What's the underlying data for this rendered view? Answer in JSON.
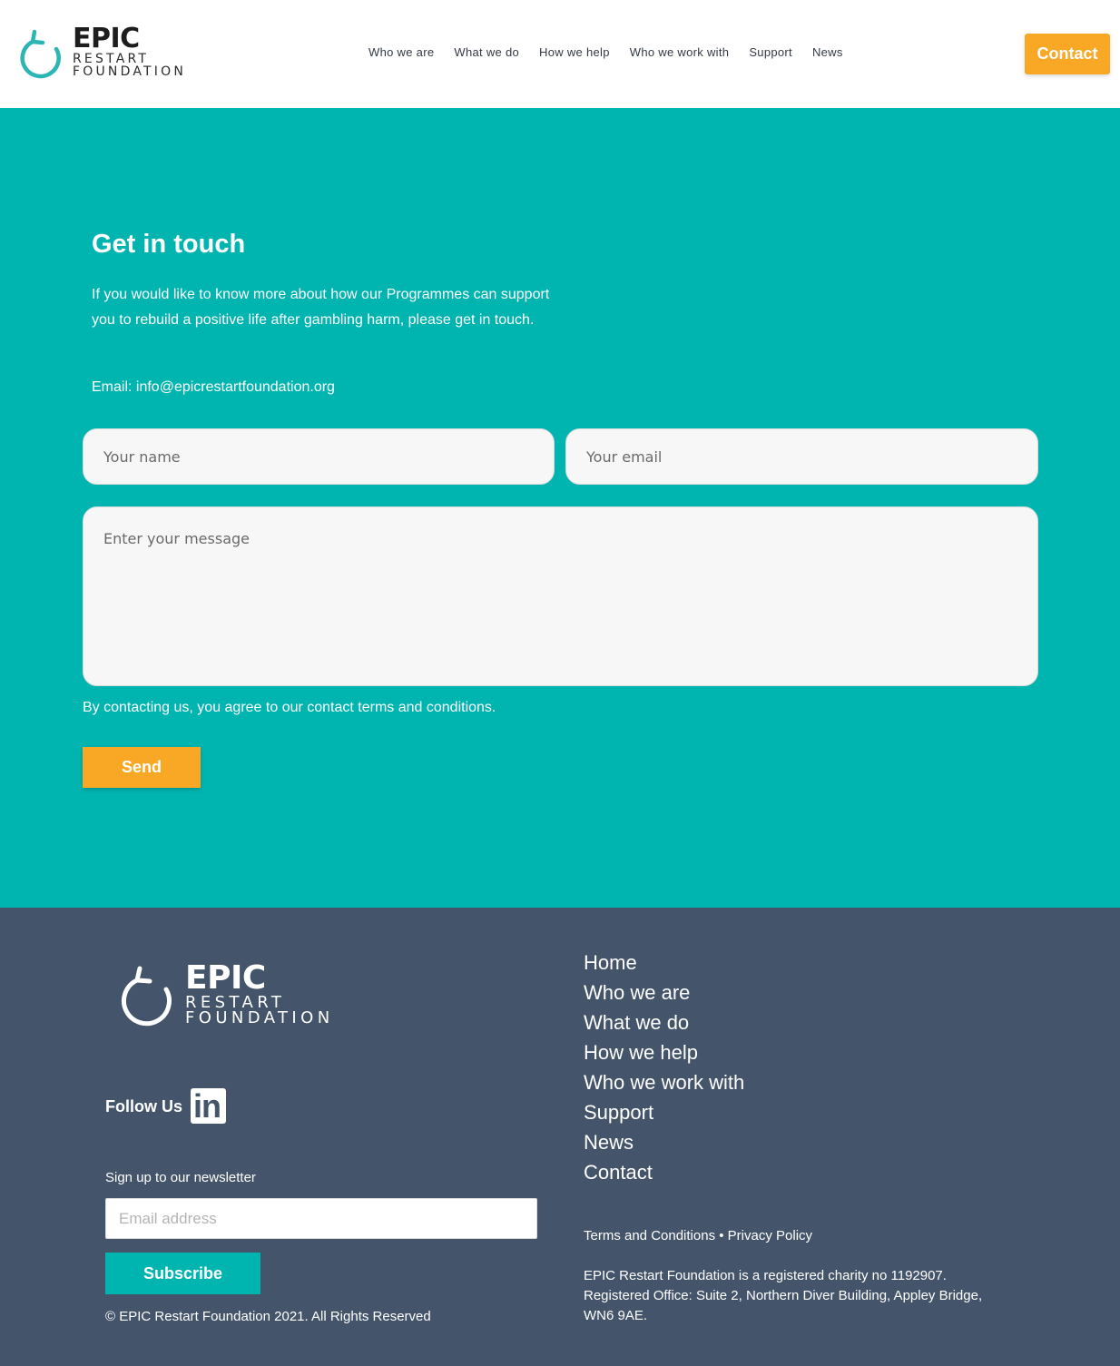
{
  "header": {
    "logo": {
      "main": "EPIC",
      "sub1": "RESTART",
      "sub2": "FOUNDATION"
    },
    "nav": [
      "Who we are",
      "What we do",
      "How we help",
      "Who we work with",
      "Support",
      "News"
    ],
    "contact_label": "Contact"
  },
  "contact_section": {
    "title": "Get in touch",
    "text": "If you would like to know more about how our Programmes can support you to rebuild a positive life after gambling harm, please get in touch.",
    "email_line": "Email:  info@epicrestartfoundation.org",
    "name_placeholder": "Your name",
    "email_placeholder": "Your email",
    "message_placeholder": "Enter your message",
    "terms_text": "By contacting us, you agree to our contact terms and conditions.",
    "send_label": "Send"
  },
  "footer": {
    "logo": {
      "main": "EPIC",
      "sub1": "RESTART",
      "sub2": "FOUNDATION"
    },
    "follow_label": "Follow Us",
    "linkedin_text": "in",
    "newsletter_label": "Sign up to our newsletter",
    "newsletter_placeholder": "Email address",
    "subscribe_label": "Subscribe",
    "copyright": "© EPIC Restart Foundation 2021. All Rights Reserved",
    "nav": [
      "Home",
      "Who we are",
      "What we do",
      "How we help",
      "Who we work with",
      "Support",
      "News",
      "Contact"
    ],
    "terms_link": "Terms and Conditions",
    "separator": " • ",
    "privacy_link": "Privacy Policy",
    "charity_line1": "EPIC Restart Foundation is a registered charity no 1192907.",
    "charity_line2": "Registered Office: Suite 2, Northern Diver Building, Appley Bridge,",
    "charity_line3": "WN6 9AE."
  },
  "colors": {
    "teal": "#00b4b0",
    "orange": "#f9a825",
    "footer_bg": "#44546a"
  },
  "icons": {
    "header_logo": "restart-arrow-icon",
    "footer_logo": "restart-arrow-icon",
    "social": "linkedin-icon"
  }
}
